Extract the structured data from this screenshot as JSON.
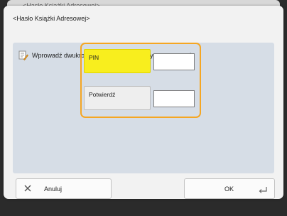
{
  "background_window": {
    "title": "<Hasło Książki Adresowej>"
  },
  "dialog": {
    "title": "<Hasło Książki Adresowej>",
    "message": "Wprowadź dwukrotnie używając klawiatury numerycznej.",
    "message_icon": "info-pencil-icon",
    "fields": {
      "pin": {
        "label": "PIN",
        "value": ""
      },
      "confirm": {
        "label": "Potwierdź",
        "value": ""
      }
    },
    "buttons": {
      "cancel": {
        "label": "Anuluj",
        "icon": "close-icon"
      },
      "ok": {
        "label": "OK",
        "icon": "enter-return-icon"
      }
    }
  },
  "colors": {
    "highlight_border": "#f5a623",
    "selected_field": "#f8ee1e",
    "panel": "#d6dde6"
  }
}
